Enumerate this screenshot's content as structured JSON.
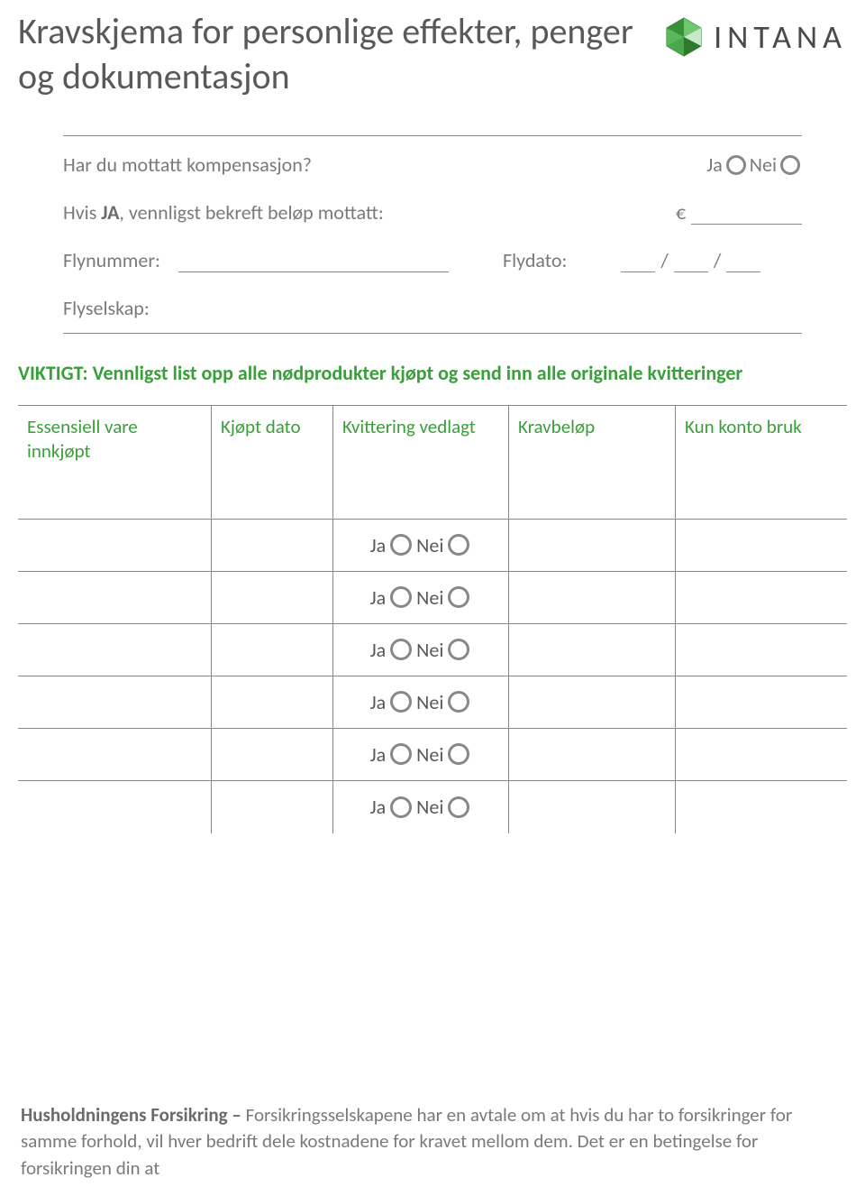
{
  "brand": {
    "name": "INTANA"
  },
  "title": "Kravskjema for personlige effekter, penger og dokumentasjon",
  "labels": {
    "compensation_q": "Har du mottatt kompensasjon?",
    "ja": "Ja",
    "nei": "Nei",
    "confirm_prefix": "Hvis ",
    "confirm_bold": "JA",
    "confirm_suffix": ", vennligst bekreft beløp mottatt:",
    "euro": "€",
    "flynummer": "Flynummer:",
    "flydato": "Flydato:",
    "slash": "/",
    "flyselskap": "Flyselskap:"
  },
  "important_note": "VIKTIGT: Vennligst list opp alle nødprodukter kjøpt og send inn alle originale kvitteringer",
  "table": {
    "headers": {
      "col1_line1": "Essensiell vare",
      "col1_line2": "innkjøpt",
      "col2": "Kjøpt dato",
      "col3": "Kvittering vedlagt",
      "col4": "Kravbeløp",
      "col5": "Kun konto bruk"
    },
    "ja": "Ja",
    "nei": "Nei",
    "row_count": 6
  },
  "footer": {
    "lead": "Husholdningens Forsikring – ",
    "body": "Forsikringsselskapene har en avtale om at hvis du har to forsikringer for samme forhold, vil hver bedrift dele kostnadene for kravet mellom dem. Det er en betingelse for forsikringen din at"
  }
}
